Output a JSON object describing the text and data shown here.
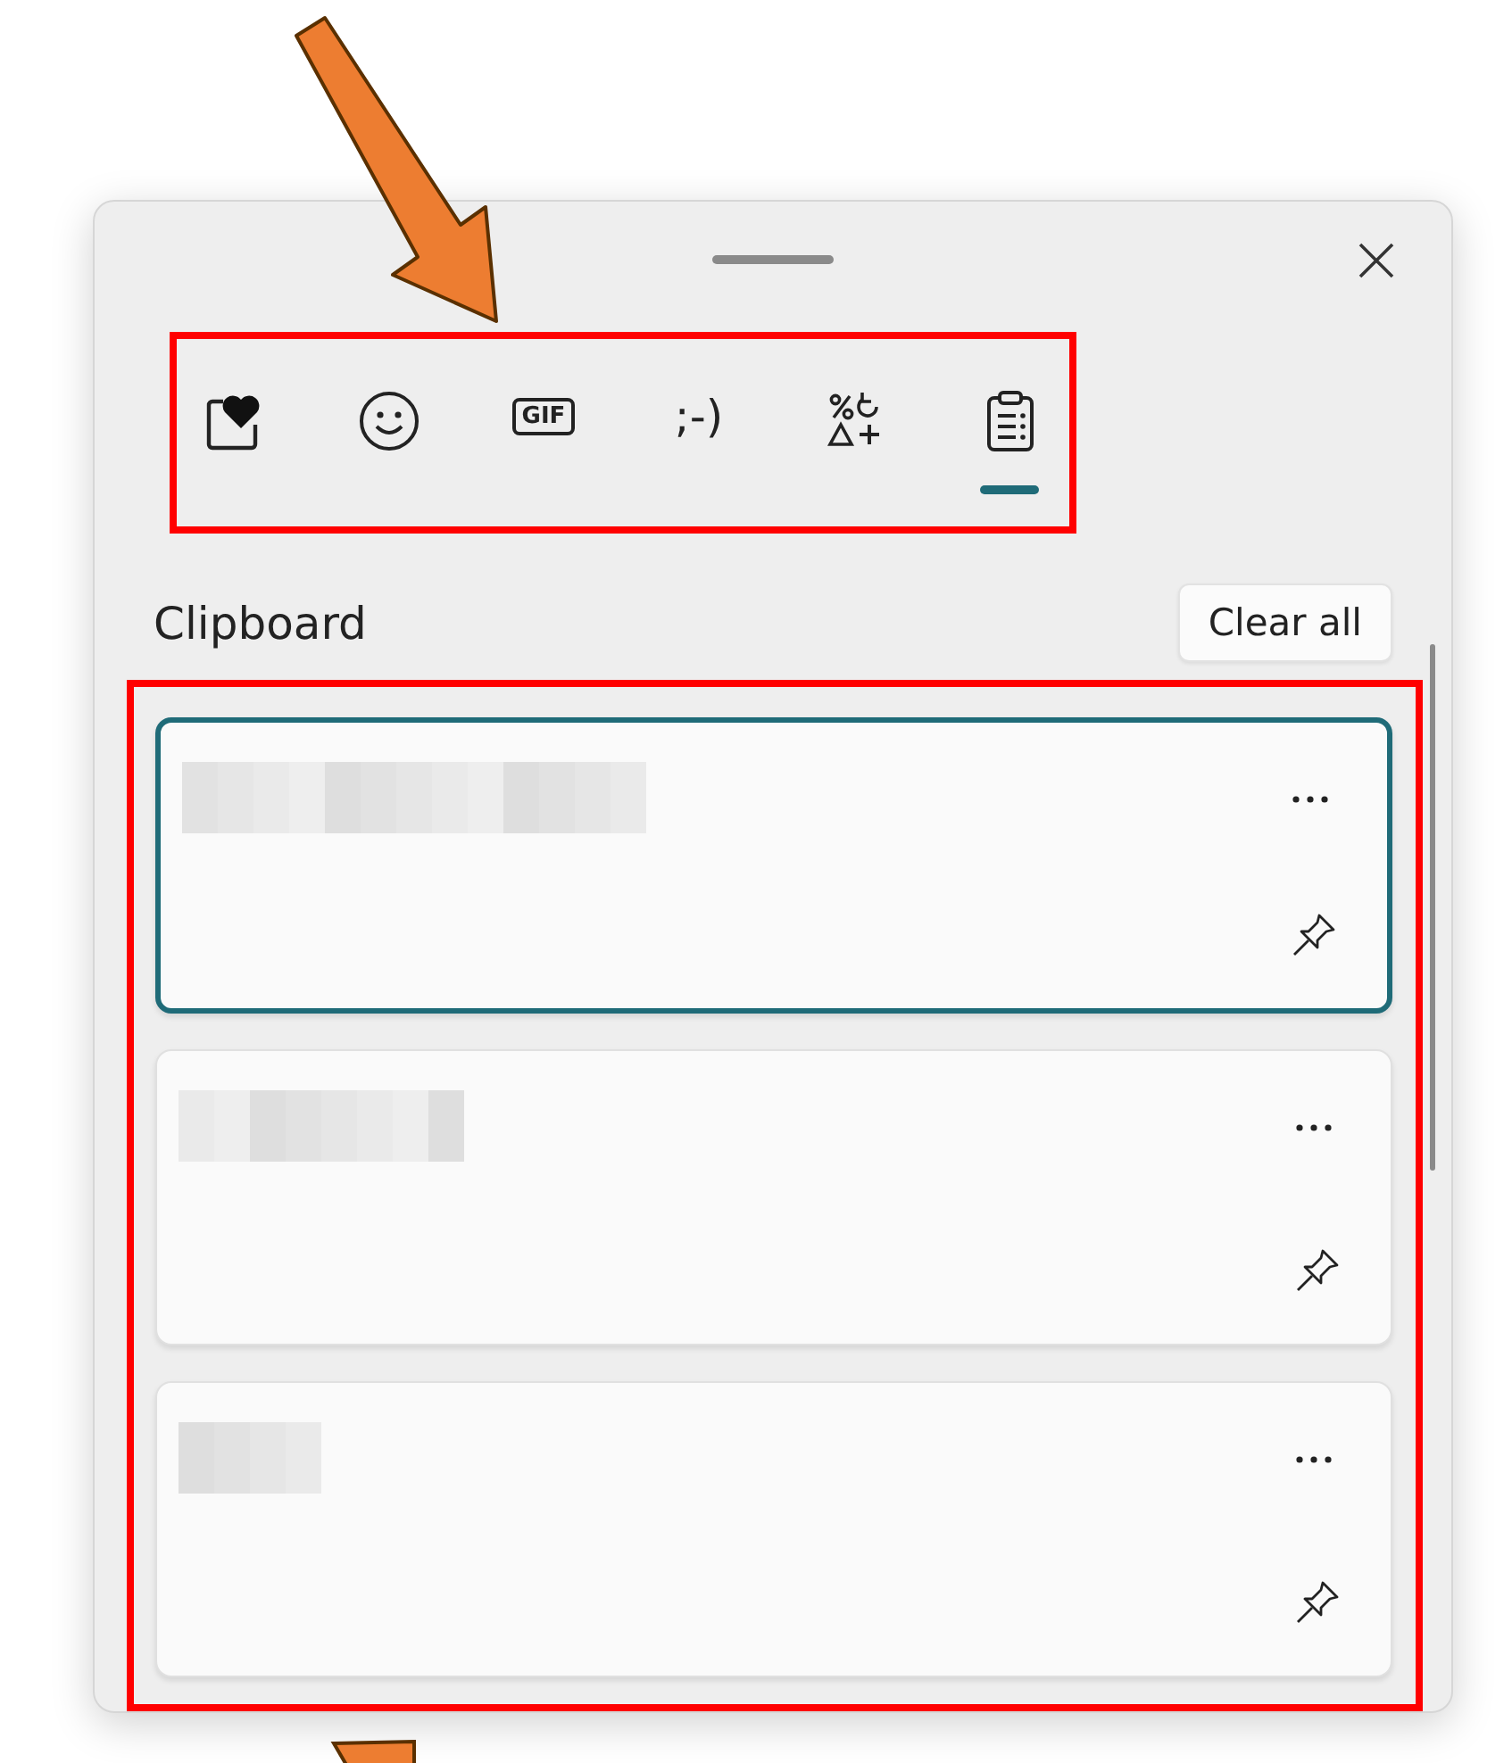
{
  "tabs": [
    {
      "kind": "favorites",
      "selected": false
    },
    {
      "kind": "emoji",
      "selected": false
    },
    {
      "kind": "gif",
      "label": "GIF",
      "selected": false
    },
    {
      "kind": "kaomoji",
      "label": ";-)",
      "selected": false
    },
    {
      "kind": "symbols",
      "selected": false
    },
    {
      "kind": "clipboard",
      "selected": true
    }
  ],
  "heading": "Clipboard",
  "clear_button": "Clear all",
  "items": [
    {
      "selected": true,
      "pinned": false
    },
    {
      "selected": false,
      "pinned": false
    },
    {
      "selected": false,
      "pinned": false
    }
  ]
}
